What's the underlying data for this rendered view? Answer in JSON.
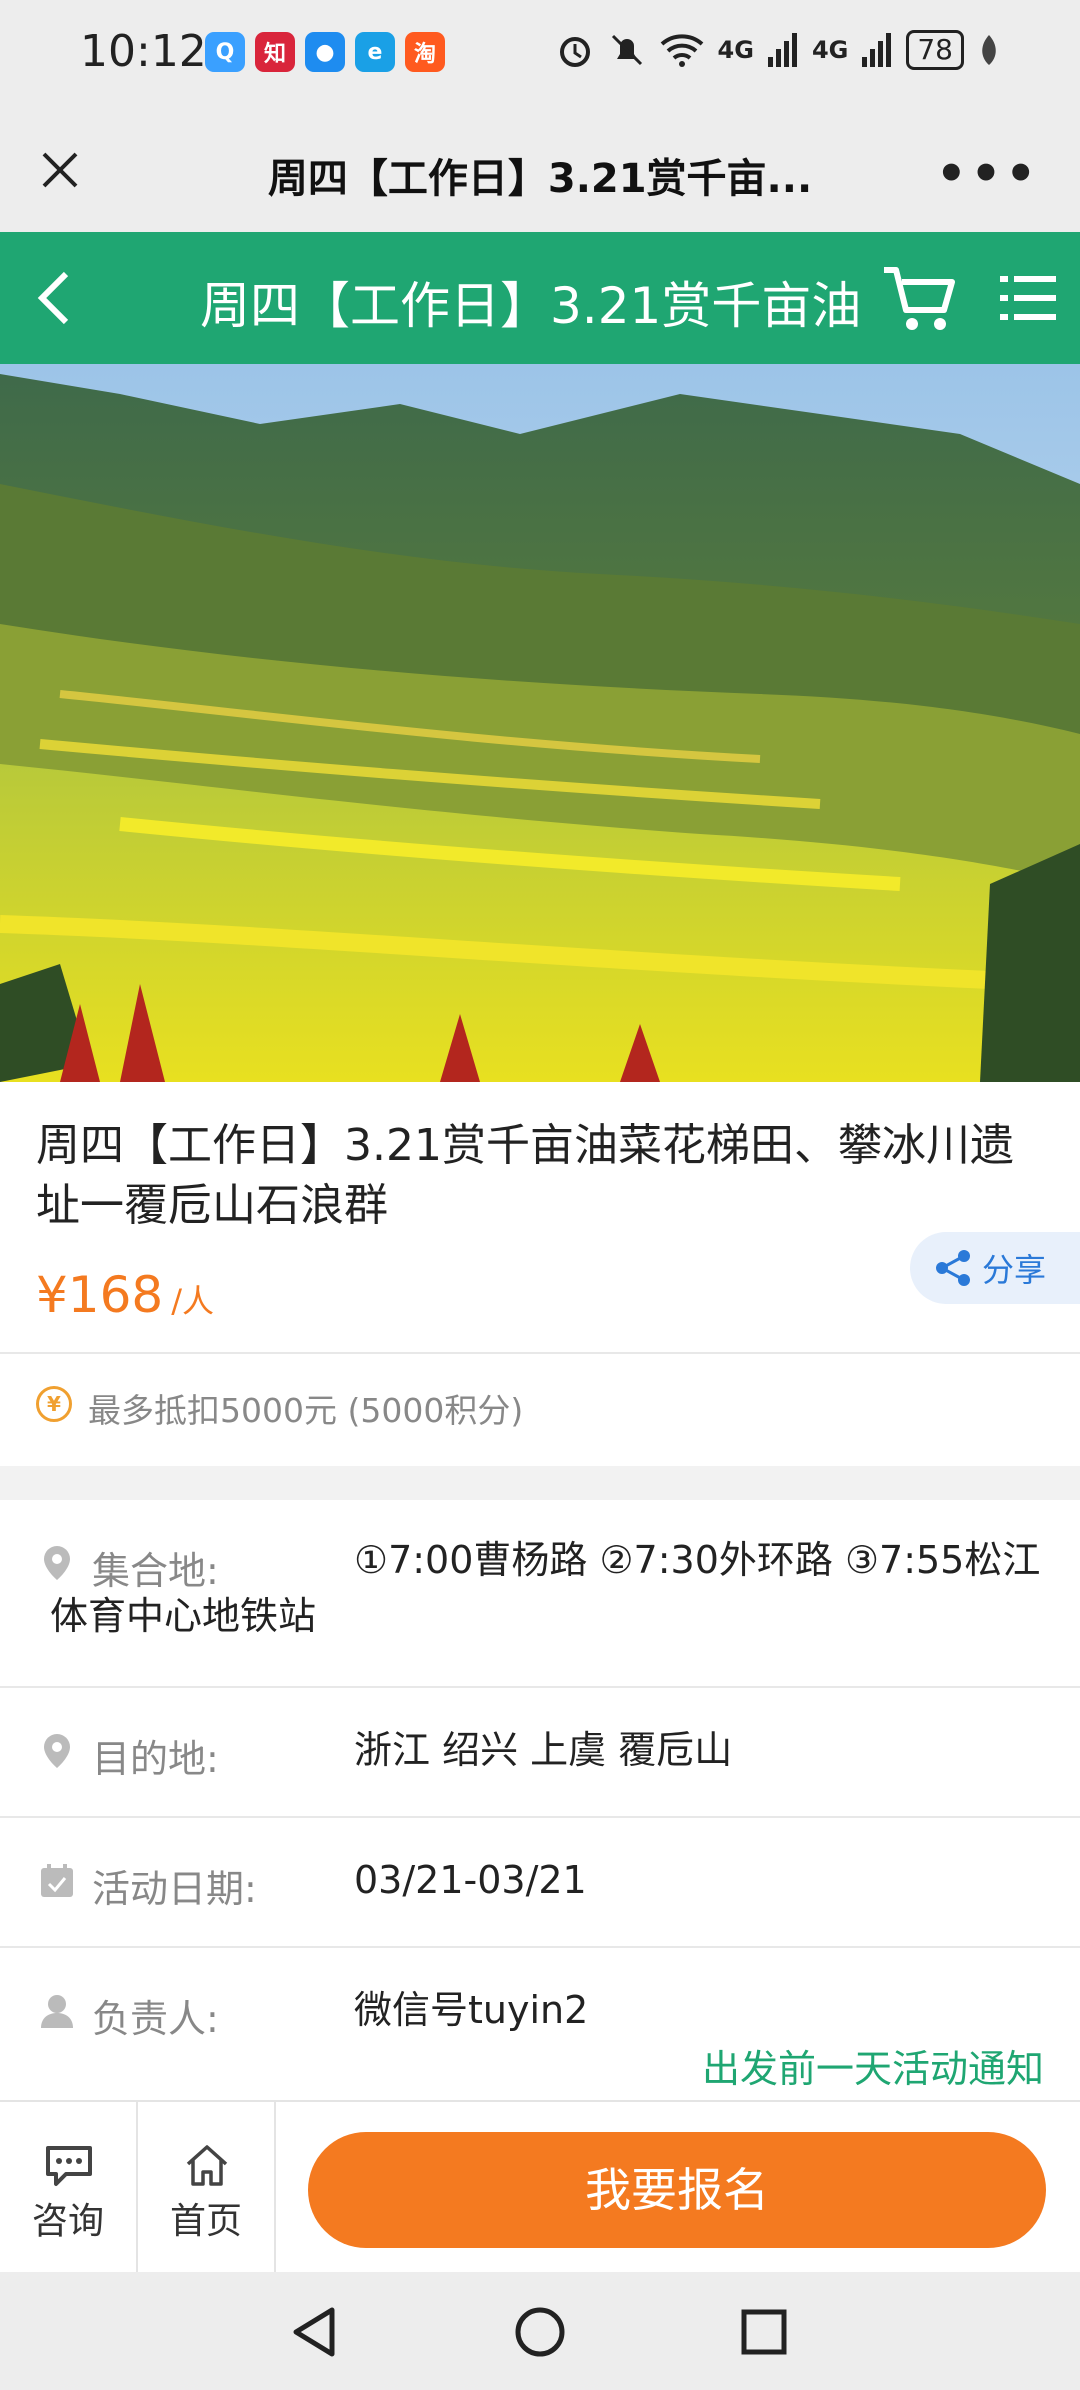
{
  "status_bar": {
    "time": "10:12",
    "notifications": [
      {
        "name": "qq-browser-icon",
        "glyph": "Q",
        "color": "#3aa0ff"
      },
      {
        "name": "zhihu-icon",
        "glyph": "知",
        "color": "#d9253b"
      },
      {
        "name": "message-icon",
        "glyph": "●",
        "color": "#1e8cf0"
      },
      {
        "name": "edge-icon",
        "glyph": "e",
        "color": "#1aa0e6"
      },
      {
        "name": "taobao-icon",
        "glyph": "淘",
        "color": "#ff5a1f"
      }
    ],
    "signal1": "4G",
    "signal2": "4G",
    "battery": "78"
  },
  "wechat_bar": {
    "title": "周四【工作日】3.21赏千亩...",
    "more": "•••"
  },
  "app_bar": {
    "title": "周四【工作日】3.21赏千亩油"
  },
  "product": {
    "title": "周四【工作日】3.21赏千亩油菜花梯田、攀冰川遗址一覆卮山石浪群",
    "price": "¥168",
    "price_unit": "/人",
    "share_label": "分享",
    "points_text": "最多抵扣5000元 (5000积分)"
  },
  "info": {
    "gather_label": "集合地:",
    "gather_value": "①7:00曹杨路 ②7:30外环路 ③7:55松江体育中心地铁站",
    "dest_label": "目的地:",
    "dest_value": "浙江 绍兴 上虞 覆卮山",
    "date_label": "活动日期:",
    "date_value": "03/21-03/21",
    "leader_label": "负责人:",
    "leader_value": "微信号tuyin2",
    "notice": "出发前一天活动通知"
  },
  "bottom_bar": {
    "consult_label": "咨询",
    "home_label": "首页",
    "signup_label": "我要报名"
  },
  "colors": {
    "brand_green": "#1fa672",
    "accent_orange": "#f47a20",
    "share_blue": "#2a79d8"
  }
}
